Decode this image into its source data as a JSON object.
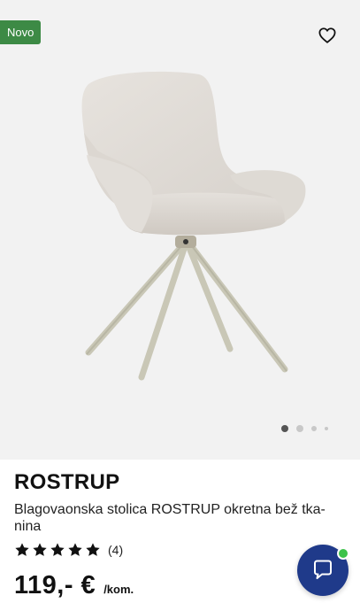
{
  "gallery": {
    "badge": "Novo",
    "favorite_icon": "heart-outline-icon",
    "slides": 4,
    "active_slide": 1
  },
  "product": {
    "name": "ROSTRUP",
    "description": "Blagovaonska stolica ROSTRUP okretna bež tka-nina",
    "rating": 5,
    "reviews": "(4)",
    "price": "119,- €",
    "unit": "/kom."
  },
  "chat": {
    "icon": "chat-bubble-icon",
    "status_color": "#3cc24a"
  },
  "colors": {
    "badge": "#3d8a45",
    "chat_button": "#1f3a8a"
  }
}
